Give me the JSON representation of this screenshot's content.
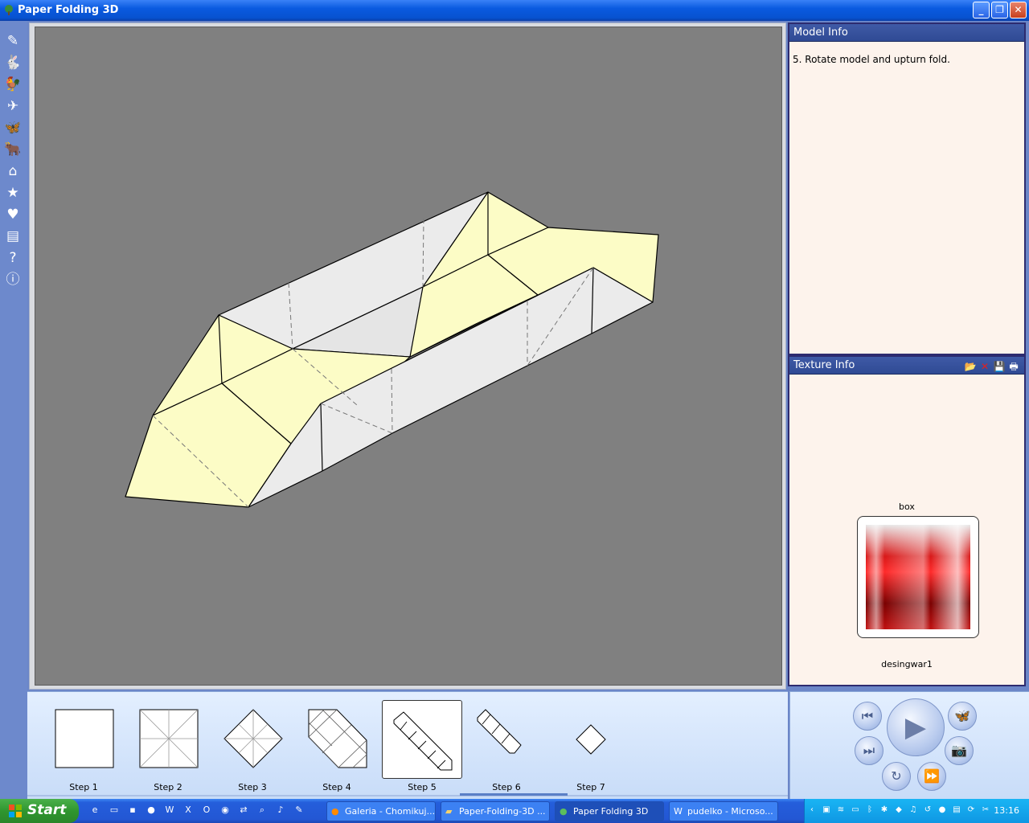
{
  "window": {
    "title": "Paper Folding 3D",
    "minimize": "_",
    "restore": "❐",
    "close": "✕"
  },
  "toolbar": {
    "tools": [
      {
        "name": "pen-tool-icon",
        "glyph": "✎"
      },
      {
        "name": "rabbit-icon",
        "glyph": "🐇"
      },
      {
        "name": "bird-icon",
        "glyph": "🐓"
      },
      {
        "name": "plane-icon",
        "glyph": "✈"
      },
      {
        "name": "butterfly-icon",
        "glyph": "🦋"
      },
      {
        "name": "bull-icon",
        "glyph": "🐂"
      },
      {
        "name": "house-icon",
        "glyph": "⌂"
      },
      {
        "name": "star-icon",
        "glyph": "★"
      },
      {
        "name": "heart-icon",
        "glyph": "♥"
      },
      {
        "name": "card-icon",
        "glyph": "▤"
      },
      {
        "name": "help-icon",
        "glyph": "?"
      },
      {
        "name": "info-icon",
        "glyph": "ⓘ"
      }
    ]
  },
  "model_info": {
    "title": "Model Info",
    "text": "5. Rotate model and upturn fold."
  },
  "texture_info": {
    "title": "Texture Info",
    "texture_name": "box",
    "image_caption": "desingwar1"
  },
  "steps": [
    {
      "label": "Step 1",
      "selected": false
    },
    {
      "label": "Step 2",
      "selected": false
    },
    {
      "label": "Step 3",
      "selected": false
    },
    {
      "label": "Step 4",
      "selected": false
    },
    {
      "label": "Step 5",
      "selected": true
    },
    {
      "label": "Step 6",
      "selected": false
    },
    {
      "label": "Step 7",
      "selected": false
    }
  ],
  "playback": {
    "first": "⏮",
    "play": "▶",
    "butterfly": "🦋",
    "last": "⏭",
    "camera": "📷",
    "rotate": "↻",
    "forward": "⏩"
  },
  "taskbar": {
    "start": "Start",
    "tasks": [
      {
        "label": "Galeria - Chomikuj...",
        "active": false
      },
      {
        "label": "Paper-Folding-3D ...",
        "active": false
      },
      {
        "label": "Paper Folding 3D",
        "active": true
      },
      {
        "label": "pudelko - Microso...",
        "active": false
      }
    ],
    "clock": "13:16"
  },
  "colors": {
    "paper_yellow": "#fcfcc6",
    "paper_white": "#ebebeb",
    "viewport_gray": "#808080",
    "panel_bg": "#fdf3ec",
    "panel_header": "#3f5aa6"
  }
}
